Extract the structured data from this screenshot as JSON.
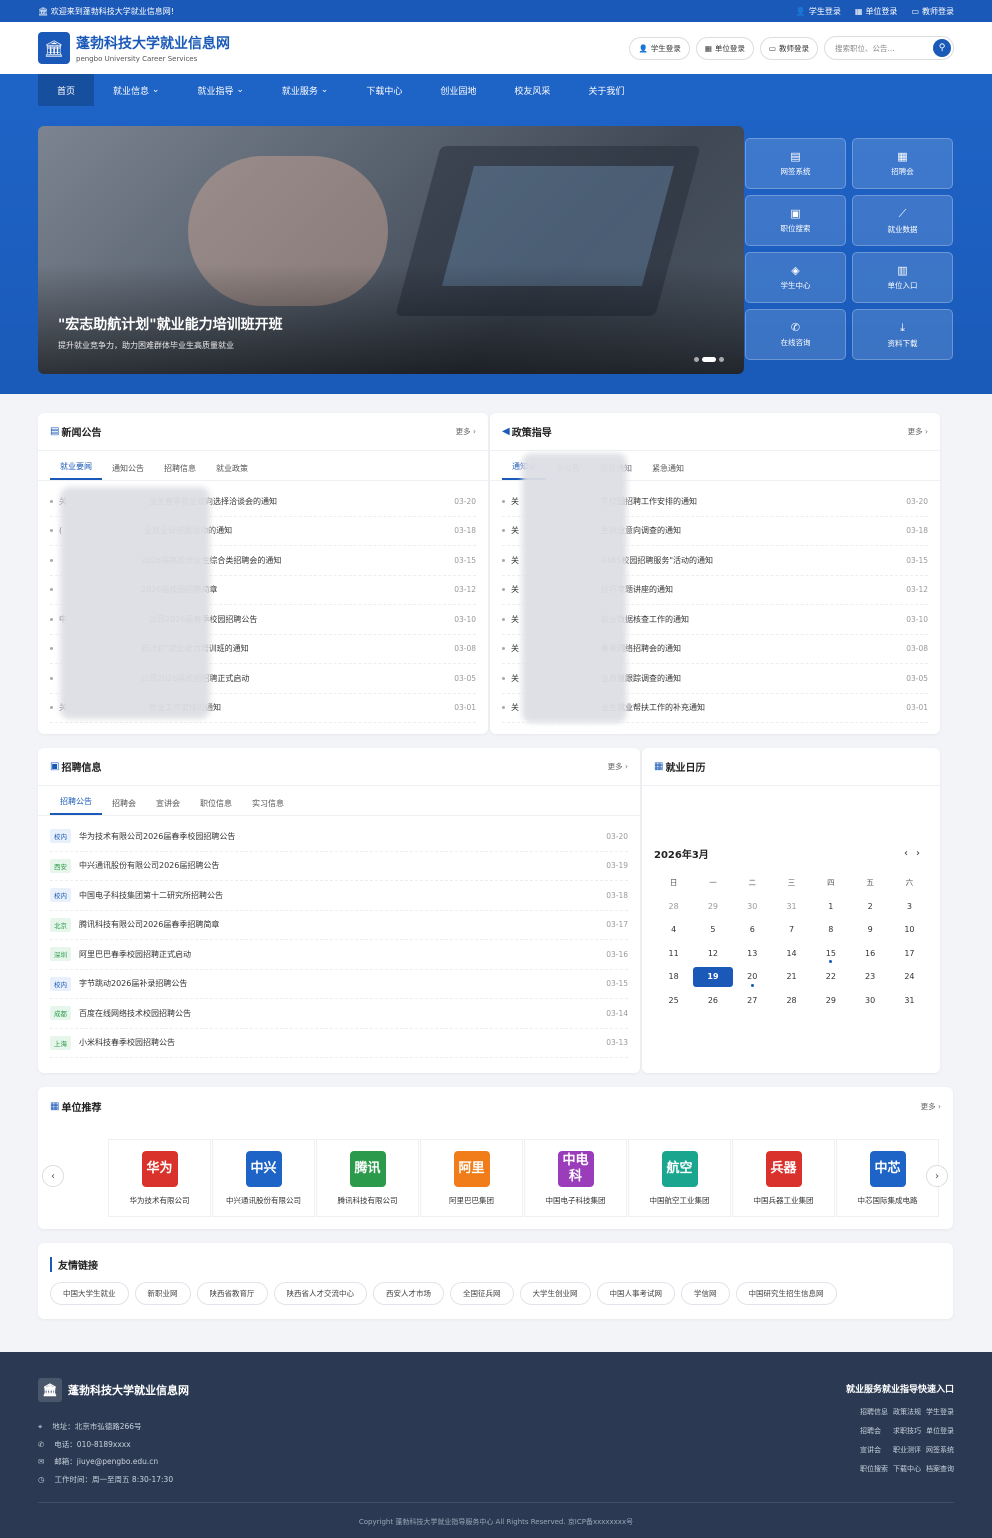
{
  "topbar": {
    "welcome": "欢迎来到蓬勃科技大学就业信息网!",
    "links": [
      "学生登录",
      "单位登录",
      "教师登录"
    ]
  },
  "header": {
    "title": "蓬勃科技大学就业信息网",
    "subtitle": "pengbo University Career Services",
    "buttons": [
      "学生登录",
      "单位登录",
      "教师登录"
    ],
    "search_placeholder": "搜索职位、公告..."
  },
  "nav": [
    "首页",
    "就业信息",
    "就业指导",
    "就业服务",
    "下载中心",
    "创业园地",
    "校友风采",
    "关于我们"
  ],
  "banner": {
    "title": "\"宏志助航计划\"就业能力培训班开班",
    "subtitle": "提升就业竞争力，助力困难群体毕业生高质量就业"
  },
  "quick": [
    {
      "label": "网签系统",
      "icon": "document-icon"
    },
    {
      "label": "招聘会",
      "icon": "calendar-icon"
    },
    {
      "label": "职位搜索",
      "icon": "briefcase-icon"
    },
    {
      "label": "就业数据",
      "icon": "chart-icon"
    },
    {
      "label": "学生中心",
      "icon": "graduate-icon"
    },
    {
      "label": "单位入口",
      "icon": "building-icon"
    },
    {
      "label": "在线咨询",
      "icon": "phone-icon"
    },
    {
      "label": "资料下载",
      "icon": "download-icon"
    }
  ],
  "news": {
    "title": "新闻公告",
    "more": "更多",
    "tabs": [
      "就业要闻",
      "通知公告",
      "招聘信息",
      "就业政策"
    ],
    "items": [
      {
        "text": "关",
        "text2": "业生春季就业双向选择洽谈会的通知",
        "date": "03-20"
      },
      {
        "text": "(",
        "text2": "业就业促进周活动的通知",
        "date": "03-18"
      },
      {
        "text": "",
        "text2": "2026届高校毕业生综合类招聘会的通知",
        "date": "03-15"
      },
      {
        "text": "",
        "text2": "2026届校园招聘简章",
        "date": "03-12"
      },
      {
        "text": "中",
        "text2": "公司2026届春季校园招聘公告",
        "date": "03-10"
      },
      {
        "text": "",
        "text2": "航计划\"就业能力培训班的通知",
        "date": "03-08"
      },
      {
        "text": "",
        "text2": "公司2026届校园招聘正式启动",
        "date": "03-05"
      },
      {
        "text": "关",
        "text2": "就业工作安排的通知",
        "date": "03-01"
      }
    ]
  },
  "policy": {
    "title": "政策指导",
    "more": "更多",
    "tabs": [
      "通知公",
      "示公告",
      "项目通知",
      "紧急通知"
    ],
    "items": [
      {
        "text": "关",
        "text2": "学校园招聘工作安排的通知",
        "date": "03-20"
      },
      {
        "text": "关",
        "text2": "生就业意向调查的通知",
        "date": "03-18"
      },
      {
        "text": "关",
        "text2": "4365校园招聘服务\"活动的通知",
        "date": "03-15"
      },
      {
        "text": "关",
        "text2": "技巧专题讲座的通知",
        "date": "03-12"
      },
      {
        "text": "关",
        "text2": "就业数据核查工作的通知",
        "date": "03-10"
      },
      {
        "text": "关",
        "text2": "春季网络招聘会的通知",
        "date": "03-08"
      },
      {
        "text": "关",
        "text2": "业质量跟踪调查的通知",
        "date": "03-05"
      },
      {
        "text": "关",
        "text2": "业生就业帮扶工作的补充通知",
        "date": "03-01"
      }
    ]
  },
  "recruit": {
    "title": "招聘信息",
    "more": "更多",
    "tabs": [
      "招聘公告",
      "招聘会",
      "宣讲会",
      "职位信息",
      "实习信息"
    ],
    "items": [
      {
        "tag": "校内",
        "color": "blue",
        "text": "华为技术有限公司2026届春季校园招聘公告",
        "date": "03-20"
      },
      {
        "tag": "西安",
        "color": "green",
        "text": "中兴通讯股份有限公司2026届招聘公告",
        "date": "03-19"
      },
      {
        "tag": "校内",
        "color": "blue",
        "text": "中国电子科技集团第十二研究所招聘公告",
        "date": "03-18"
      },
      {
        "tag": "北京",
        "color": "green",
        "text": "腾讯科技有限公司2026届春季招聘简章",
        "date": "03-17"
      },
      {
        "tag": "深圳",
        "color": "green",
        "text": "阿里巴巴春季校园招聘正式启动",
        "date": "03-16"
      },
      {
        "tag": "校内",
        "color": "blue",
        "text": "字节跳动2026届补录招聘公告",
        "date": "03-15"
      },
      {
        "tag": "成都",
        "color": "green",
        "text": "百度在线网络技术校园招聘公告",
        "date": "03-14"
      },
      {
        "tag": "上海",
        "color": "green",
        "text": "小米科技春季校园招聘公告",
        "date": "03-13"
      }
    ]
  },
  "calendar": {
    "title": "就业日历",
    "month": "2026年3月",
    "weekdays": [
      "日",
      "一",
      "二",
      "三",
      "四",
      "五",
      "六"
    ],
    "days": [
      {
        "d": "28",
        "m": true
      },
      {
        "d": "29",
        "m": true
      },
      {
        "d": "30",
        "m": true
      },
      {
        "d": "31",
        "m": true
      },
      {
        "d": "1"
      },
      {
        "d": "2"
      },
      {
        "d": "3"
      },
      {
        "d": "4"
      },
      {
        "d": "5"
      },
      {
        "d": "6"
      },
      {
        "d": "7"
      },
      {
        "d": "8"
      },
      {
        "d": "9"
      },
      {
        "d": "10"
      },
      {
        "d": "11"
      },
      {
        "d": "12"
      },
      {
        "d": "13"
      },
      {
        "d": "14"
      },
      {
        "d": "15",
        "e": true
      },
      {
        "d": "16"
      },
      {
        "d": "17"
      },
      {
        "d": "18"
      },
      {
        "d": "19",
        "t": true
      },
      {
        "d": "20",
        "e": true
      },
      {
        "d": "21"
      },
      {
        "d": "22"
      },
      {
        "d": "23"
      },
      {
        "d": "24"
      },
      {
        "d": "25"
      },
      {
        "d": "26"
      },
      {
        "d": "27"
      },
      {
        "d": "28"
      },
      {
        "d": "29"
      },
      {
        "d": "30"
      },
      {
        "d": "31"
      }
    ]
  },
  "companies": {
    "title": "单位推荐",
    "more": "更多",
    "items": [
      {
        "logo": "华为",
        "name": "华为技术有限公司",
        "color": "#d9322c"
      },
      {
        "logo": "中兴",
        "name": "中兴通讯股份有限公司",
        "color": "#1e63c6"
      },
      {
        "logo": "腾讯",
        "name": "腾讯科技有限公司",
        "color": "#2b9a4b"
      },
      {
        "logo": "阿里",
        "name": "阿里巴巴集团",
        "color": "#f07d1a"
      },
      {
        "logo": "中电科",
        "name": "中国电子科技集团",
        "color": "#9b3dbb"
      },
      {
        "logo": "航空",
        "name": "中国航空工业集团",
        "color": "#1aa58f"
      },
      {
        "logo": "兵器",
        "name": "中国兵器工业集团",
        "color": "#d9322c"
      },
      {
        "logo": "中芯",
        "name": "中芯国际集成电路",
        "color": "#1e63c6"
      }
    ]
  },
  "friend_links": {
    "title": "友情链接",
    "items": [
      "中国大学生就业",
      "新职业网",
      "陕西省教育厅",
      "陕西省人才交流中心",
      "西安人才市场",
      "全国征兵网",
      "大学生创业网",
      "中国人事考试网",
      "学信网",
      "中国研究生招生信息网"
    ]
  },
  "footer": {
    "title": "蓬勃科技大学就业信息网",
    "address": "地址：北京市弘德路266号",
    "phone": "电话：010-8189xxxx",
    "email": "邮箱：jiuye@pengbo.edu.cn",
    "hours": "工作时间：周一至周五 8:30-17:30",
    "quick_title": "就业服务就业指导快速入口",
    "quick_links": [
      "招聘信息",
      "政策法规",
      "学生登录",
      "招聘会",
      "求职技巧",
      "单位登录",
      "宣讲会",
      "职业测评",
      "网签系统",
      "职位搜索",
      "下载中心",
      "档案查询"
    ],
    "copyright": "Copyright 蓬勃科技大学就业指导服务中心 All Rights Reserved. 京ICP备xxxxxxxx号"
  }
}
